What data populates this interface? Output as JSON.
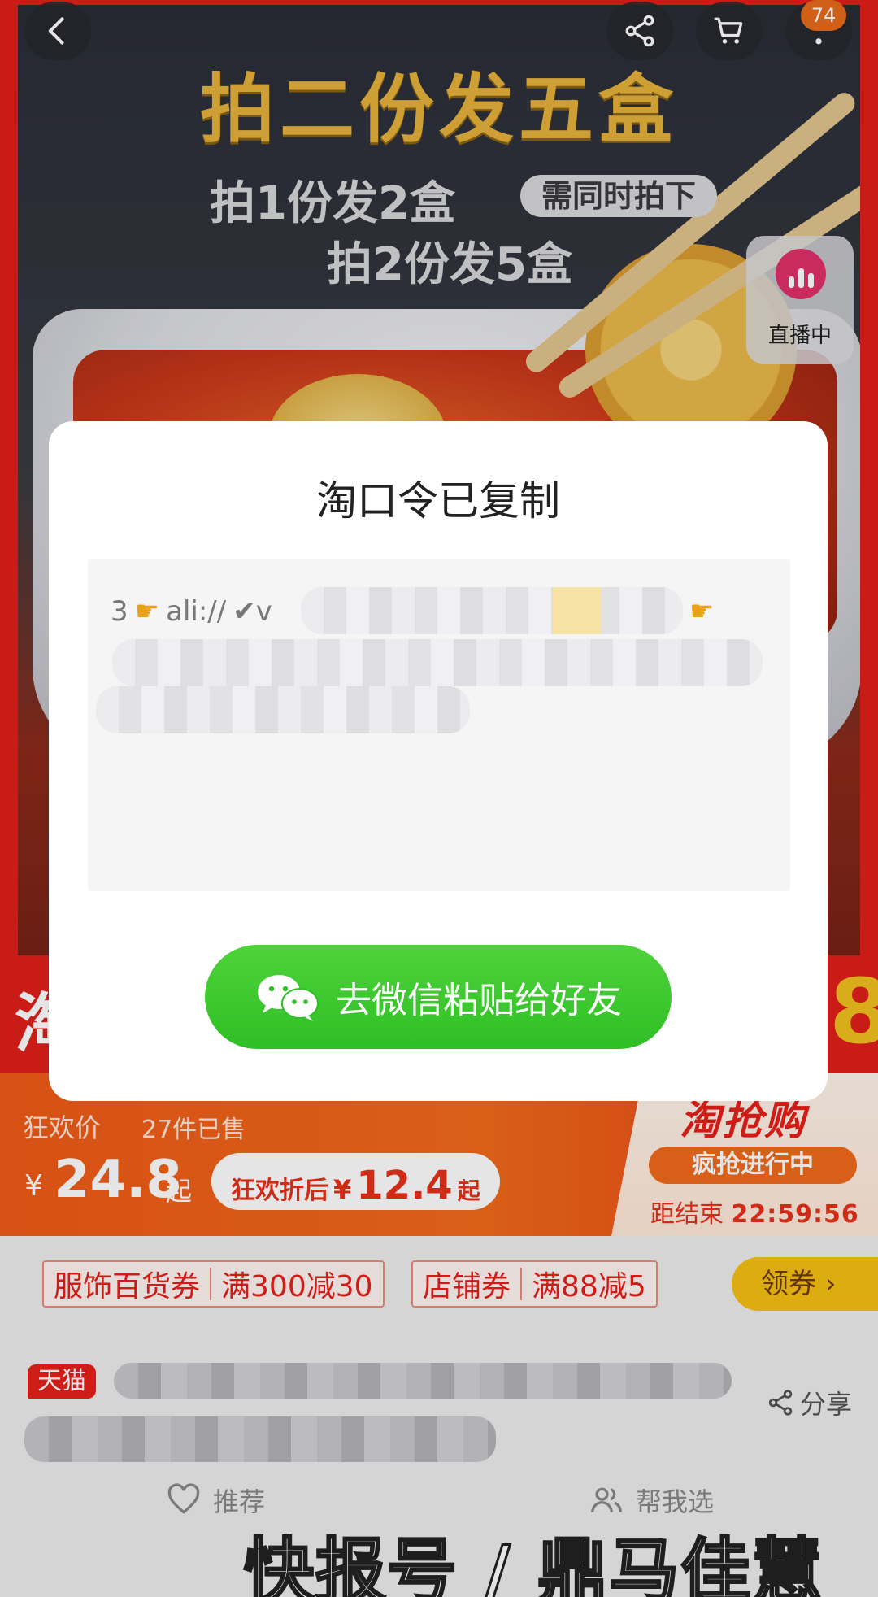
{
  "hero": {
    "title": "拍二份发五盒",
    "sub1": "拍1份发2盒",
    "sub_badge": "需同时拍下",
    "sub2": "拍2份发5盒",
    "cart_badge": "74",
    "live_label": "直播中"
  },
  "dialog": {
    "title": "淘口令已复制",
    "code_prefix": "3",
    "code_scheme": "ali://",
    "code_check": "✔v",
    "wechat_button": "去微信粘贴给好友"
  },
  "price": {
    "label": "狂欢价",
    "sold": "27件已售",
    "yen": "¥",
    "value": "24.8",
    "qi": "起",
    "after_label": "狂欢折后",
    "after_yen": "¥",
    "after_value": "12.4",
    "after_qi": "起",
    "flash_logo": "淘抢购",
    "flash_status": "疯抢进行中",
    "countdown_label": "距结束",
    "countdown": "22:59:56"
  },
  "coupons": [
    {
      "type": "服饰百货券",
      "rule": "满300减30"
    },
    {
      "type": "店铺券",
      "rule": "满88减5"
    }
  ],
  "get_coupon": "领券",
  "product": {
    "tag": "天猫",
    "share": "分享"
  },
  "actions": {
    "recommend": "推荐",
    "help_choose": "帮我选"
  },
  "watermark": "快报号 / 鼎马佳慧",
  "colors": {
    "brand_red": "#e8201a",
    "orange": "#f26a1a",
    "wechat_green": "#2fbf26",
    "coupon_yellow": "#f6c012",
    "title_gold": "#e6b23a"
  }
}
